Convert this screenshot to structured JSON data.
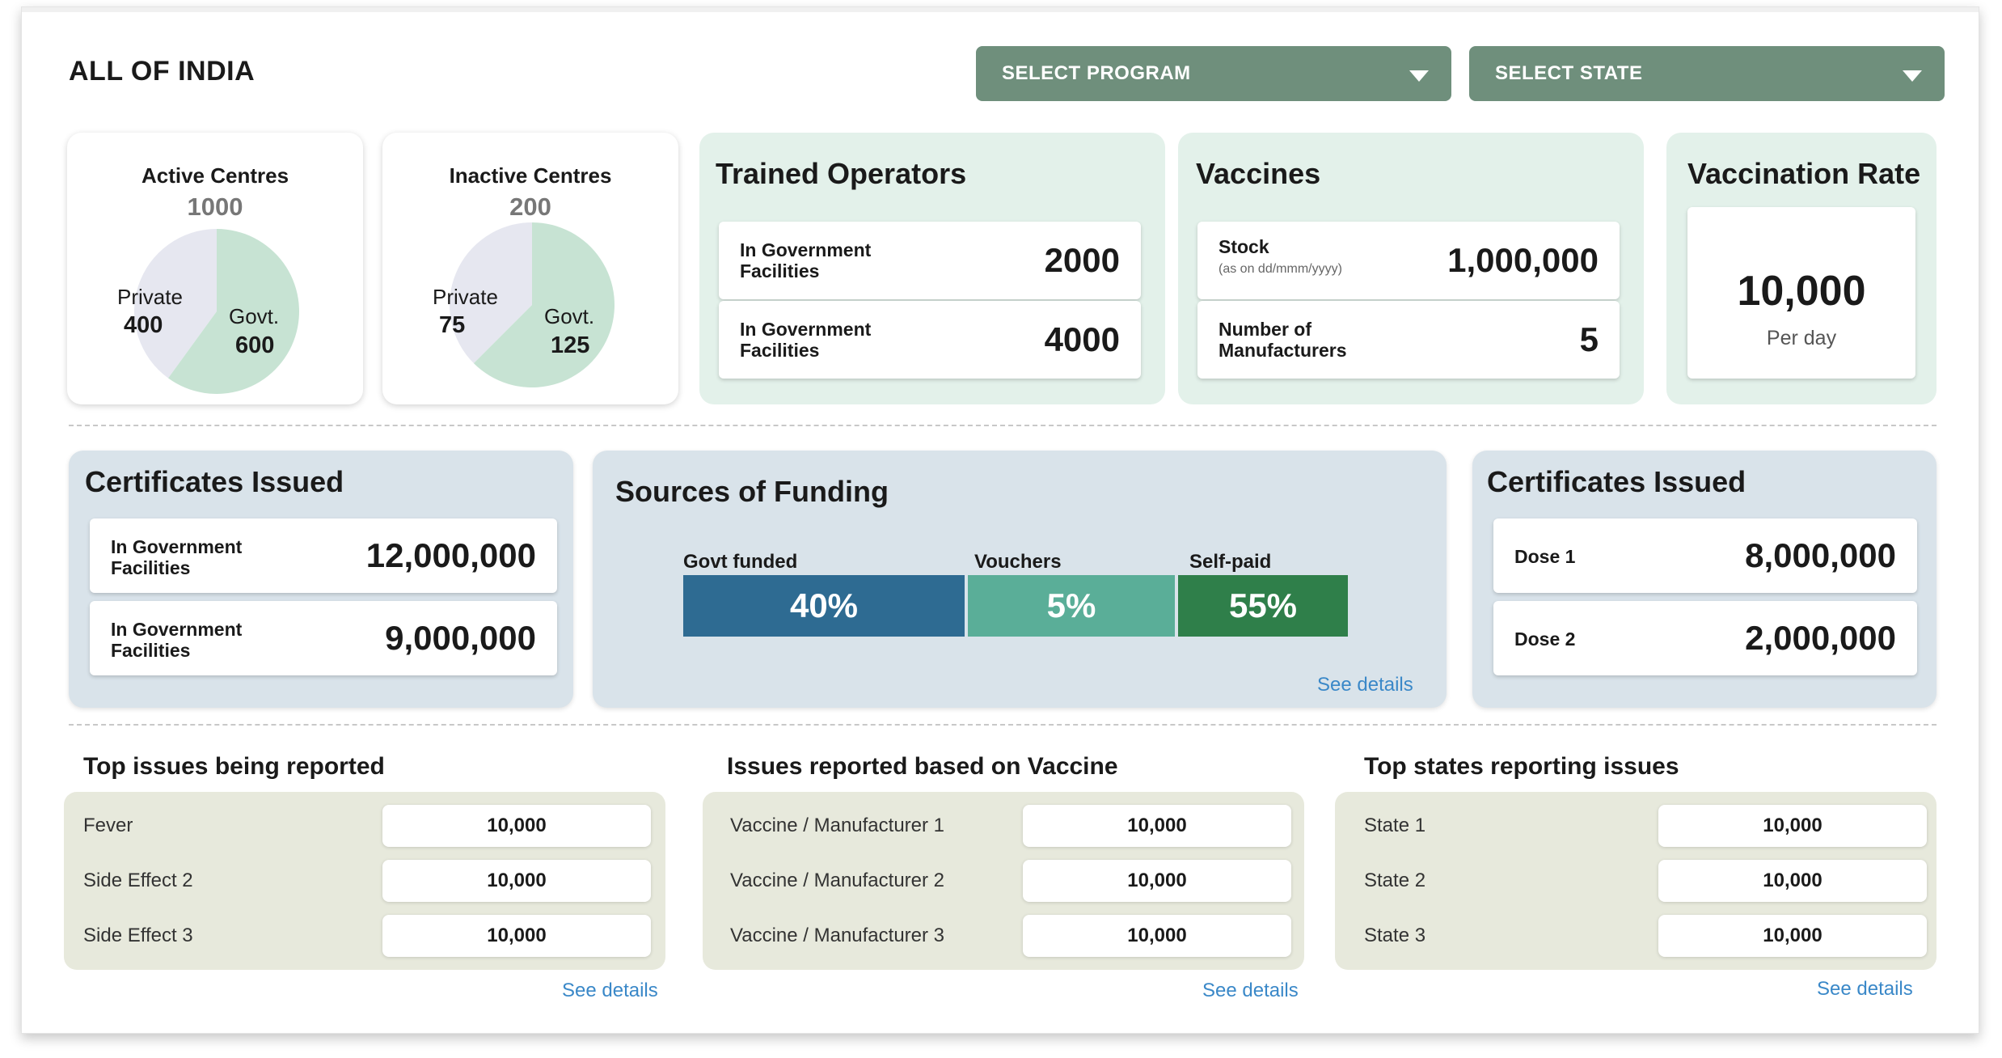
{
  "page": {
    "title": "ALL OF INDIA"
  },
  "filters": {
    "program_label": "SELECT PROGRAM",
    "state_label": "SELECT STATE"
  },
  "active_centres": {
    "title": "Active Centres",
    "total": "1000",
    "private_label": "Private",
    "private_value": "400",
    "govt_label": "Govt.",
    "govt_value": "600",
    "private_count": 400,
    "govt_count": 600
  },
  "inactive_centres": {
    "title": "Inactive Centres",
    "total": "200",
    "private_label": "Private",
    "private_value": "75",
    "govt_label": "Govt.",
    "govt_value": "125",
    "private_count": 75,
    "govt_count": 125
  },
  "trained_operators": {
    "title": "Trained Operators",
    "rows": [
      {
        "label": "In Government Facilities",
        "value": "2000"
      },
      {
        "label": "In Government Facilities",
        "value": "4000"
      }
    ]
  },
  "vaccines": {
    "title": "Vaccines",
    "stock_label": "Stock",
    "stock_sub": "(as on dd/mmm/yyyy)",
    "stock_value": "1,000,000",
    "manufacturers_label": "Number of Manufacturers",
    "manufacturers_value": "5"
  },
  "vaccination_rate": {
    "title": "Vaccination Rate",
    "value": "10,000",
    "unit": "Per day"
  },
  "certificates_facilities": {
    "title": "Certificates Issued",
    "rows": [
      {
        "label": "In Government Facilities",
        "value": "12,000,000"
      },
      {
        "label": "In Government Facilities",
        "value": "9,000,000"
      }
    ]
  },
  "funding": {
    "title": "Sources of Funding",
    "items": [
      {
        "label": "Govt funded",
        "value": "40%",
        "color": "#2e6b92"
      },
      {
        "label": "Vouchers",
        "value": "5%",
        "color": "#5aae98"
      },
      {
        "label": "Self-paid",
        "value": "55%",
        "color": "#2f7f4a"
      }
    ],
    "see_details": "See details"
  },
  "certificates_dose": {
    "title": "Certificates Issued",
    "rows": [
      {
        "label": "Dose 1",
        "value": "8,000,000"
      },
      {
        "label": "Dose 2",
        "value": "2,000,000"
      }
    ]
  },
  "top_issues": {
    "title": "Top issues being reported",
    "rows": [
      {
        "label": "Fever",
        "value": "10,000"
      },
      {
        "label": "Side Effect 2",
        "value": "10,000"
      },
      {
        "label": "Side Effect 3",
        "value": "10,000"
      }
    ],
    "see_details": "See details"
  },
  "vaccine_issues": {
    "title": "Issues reported based on Vaccine",
    "rows": [
      {
        "label": "Vaccine / Manufacturer 1",
        "value": "10,000"
      },
      {
        "label": "Vaccine / Manufacturer 2",
        "value": "10,000"
      },
      {
        "label": "Vaccine / Manufacturer 3",
        "value": "10,000"
      }
    ],
    "see_details": "See details"
  },
  "state_issues": {
    "title": "Top states reporting issues",
    "rows": [
      {
        "label": "State 1",
        "value": "10,000"
      },
      {
        "label": "State 2",
        "value": "10,000"
      },
      {
        "label": "State 3",
        "value": "10,000"
      }
    ],
    "see_details": "See details"
  },
  "colors": {
    "govt_slice": "#c7e3d3",
    "private_slice": "#e6e7f0",
    "dropdown": "#6f8f7c",
    "link": "#3a88c8"
  }
}
